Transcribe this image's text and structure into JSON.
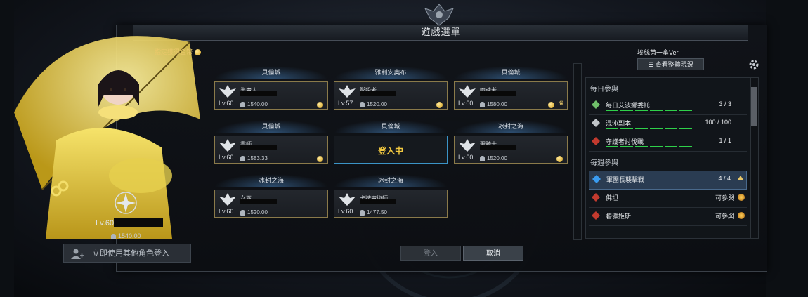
{
  "window": {
    "title": "遊戲選單"
  },
  "selected_character": {
    "reward_label": "指定獲得金幣",
    "level": "Lv.60",
    "power": "1540.00",
    "other_login_label": "立即使用其他角色登入"
  },
  "slots": [
    {
      "server": "貝倫城",
      "class": "半魔人",
      "level": "Lv.60",
      "power": "1540.00",
      "icon": "demon-hunter-icon",
      "gold": true,
      "crown": false
    },
    {
      "server": "雅利安奧布",
      "class": "影殺者",
      "level": "Lv.57",
      "power": "1520.00",
      "icon": "shadowhunter-icon",
      "gold": true,
      "crown": false
    },
    {
      "server": "貝倫城",
      "class": "喚魂者",
      "level": "Lv.60",
      "power": "1580.00",
      "icon": "soul-caller-icon",
      "gold": true,
      "crown": true
    },
    {
      "server": "貝倫城",
      "class": "畫師",
      "level": "Lv.60",
      "power": "1583.33",
      "icon": "painter-icon",
      "gold": true,
      "crown": false
    },
    {
      "server": "貝倫城",
      "class": "",
      "level": "",
      "power": "",
      "icon": "",
      "gold": false,
      "crown": false,
      "status": "登入中"
    },
    {
      "server": "冰封之海",
      "class": "聖騎士",
      "level": "Lv.60",
      "power": "1520.00",
      "icon": "paladin-icon",
      "gold": true,
      "crown": false
    },
    {
      "server": "冰封之海",
      "class": "女巫",
      "level": "Lv.60",
      "power": "1520.00",
      "icon": "sorceress-icon",
      "gold": false,
      "crown": false
    },
    {
      "server": "冰封之海",
      "class": "卡牌魔術師",
      "level": "Lv.60",
      "power": "1477.50",
      "icon": "arcanist-icon",
      "gold": false,
      "crown": false
    }
  ],
  "buttons": {
    "login": "登入",
    "cancel": "取消"
  },
  "right_panel": {
    "roster_name": "埃絲芮一傘Ver",
    "view_all": "查看整體現況",
    "daily_title": "每日參與",
    "daily": [
      {
        "name": "每日艾波娜委託",
        "value": "3 / 3",
        "icon": "guardian-icon"
      },
      {
        "name": "混沌副本",
        "value": "100 / 100",
        "icon": "chaos-icon"
      },
      {
        "name": "守護者討伐戰",
        "value": "1 / 1",
        "icon": "guardian-raid-icon"
      }
    ],
    "weekly_title": "每週參與",
    "weekly": [
      {
        "name": "軍團長襲擊戰",
        "value": "4 / 4",
        "icon": "orb-icon"
      },
      {
        "name": "佛坦",
        "value": "可參與",
        "icon": "raid-icon"
      },
      {
        "name": "碧雅姬斯",
        "value": "可參與",
        "icon": "raid-icon"
      }
    ]
  },
  "colors": {
    "accent_gold": "#e9c86a",
    "select_blue": "#3b94c7",
    "progress_green": "#2fd04a"
  }
}
